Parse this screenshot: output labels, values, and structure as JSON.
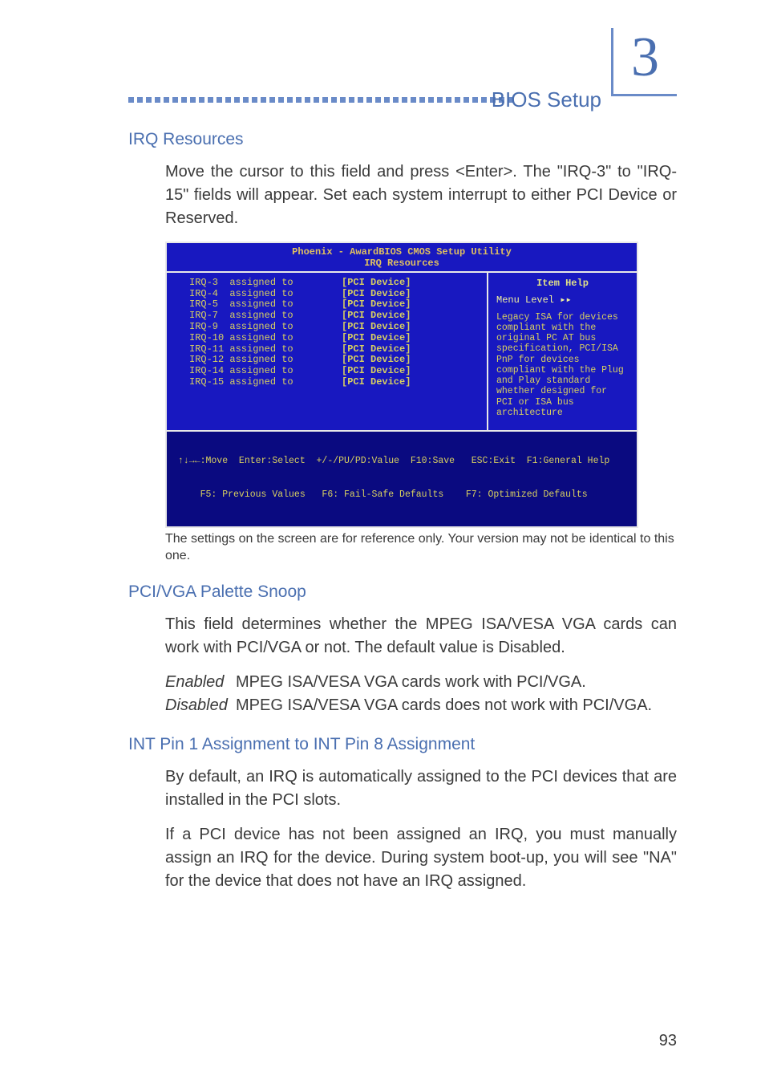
{
  "header": {
    "chapter_number": "3",
    "title": "BIOS Setup"
  },
  "sections": {
    "irq_resources": {
      "title": "IRQ Resources",
      "body": "Move the cursor to this field and press <Enter>. The \"IRQ-3\" to \"IRQ-15\" fields will appear. Set each system interrupt to either PCI Device or Reserved."
    },
    "bios_caption": "The settings on the screen are for reference only. Your version may not be identical to this one.",
    "palette_snoop": {
      "title": "PCI/VGA Palette Snoop",
      "body": "This field determines whether the MPEG ISA/VESA VGA cards can work with PCI/VGA or not. The default value is Disabled.",
      "options": [
        {
          "term": "Enabled",
          "desc": "MPEG ISA/VESA VGA cards work with PCI/VGA."
        },
        {
          "term": "Disabled",
          "desc": "MPEG ISA/VESA VGA cards does not work with PCI/VGA."
        }
      ]
    },
    "int_pin": {
      "title": "INT Pin 1 Assignment to INT Pin 8 Assignment",
      "para1": "By default, an IRQ is automatically assigned to the PCI devices that are installed in the PCI slots.",
      "para2": "If a PCI device has not been assigned an IRQ, you must manually assign an IRQ for the device. During system boot-up, you will see \"NA\" for the device that does not have an IRQ assigned."
    }
  },
  "bios": {
    "title1": "Phoenix - AwardBIOS CMOS Setup Utility",
    "title2": "IRQ Resources",
    "rows": [
      {
        "label": "IRQ-3  assigned to",
        "value": "[PCI Device]"
      },
      {
        "label": "IRQ-4  assigned to",
        "value": "[PCI Device]"
      },
      {
        "label": "IRQ-5  assigned to",
        "value": "[PCI Device]"
      },
      {
        "label": "IRQ-7  assigned to",
        "value": "[PCI Device]"
      },
      {
        "label": "IRQ-9  assigned to",
        "value": "[PCI Device]"
      },
      {
        "label": "IRQ-10 assigned to",
        "value": "[PCI Device]"
      },
      {
        "label": "IRQ-11 assigned to",
        "value": "[PCI Device]"
      },
      {
        "label": "IRQ-12 assigned to",
        "value": "[PCI Device]"
      },
      {
        "label": "IRQ-14 assigned to",
        "value": "[PCI Device]"
      },
      {
        "label": "IRQ-15 assigned to",
        "value": "[PCI Device]"
      }
    ],
    "help_title": "Item Help",
    "menu_level": "Menu Level   ▸▸",
    "help_text": "Legacy ISA for devices compliant with the original PC AT bus specification, PCI/ISA PnP for devices compliant with the Plug and Play standard whether designed for PCI or ISA bus architecture",
    "footer1": "↑↓→←:Move  Enter:Select  +/-/PU/PD:Value  F10:Save   ESC:Exit  F1:General Help",
    "footer2": "    F5: Previous Values   F6: Fail-Safe Defaults    F7: Optimized Defaults"
  },
  "page_number": "93"
}
